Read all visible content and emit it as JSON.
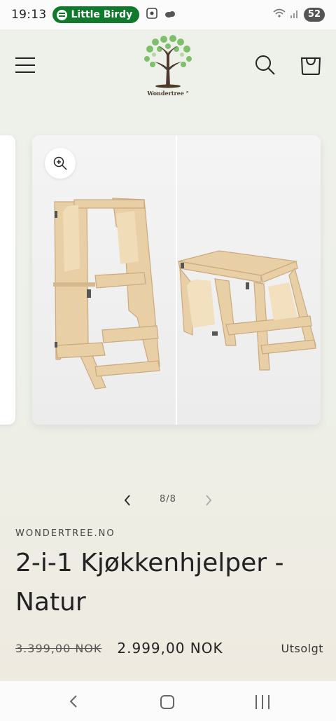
{
  "status_bar": {
    "time": "19:13",
    "now_playing": "Little Birdy",
    "battery": "52"
  },
  "header": {
    "logo_text": "Wondertree",
    "logo_mark": "°"
  },
  "gallery": {
    "counter": "8/8"
  },
  "product": {
    "vendor": "WONDERTREE.NO",
    "title": "2-i-1 Kjøkkenhjelper - Natur",
    "old_price": "3.399,00 NOK",
    "price": "2.999,00 NOK",
    "badge": "Utsolgt"
  },
  "colors": {
    "spotify_green": "#0f7a2c",
    "background": "#eef1ea",
    "text": "#222222"
  }
}
